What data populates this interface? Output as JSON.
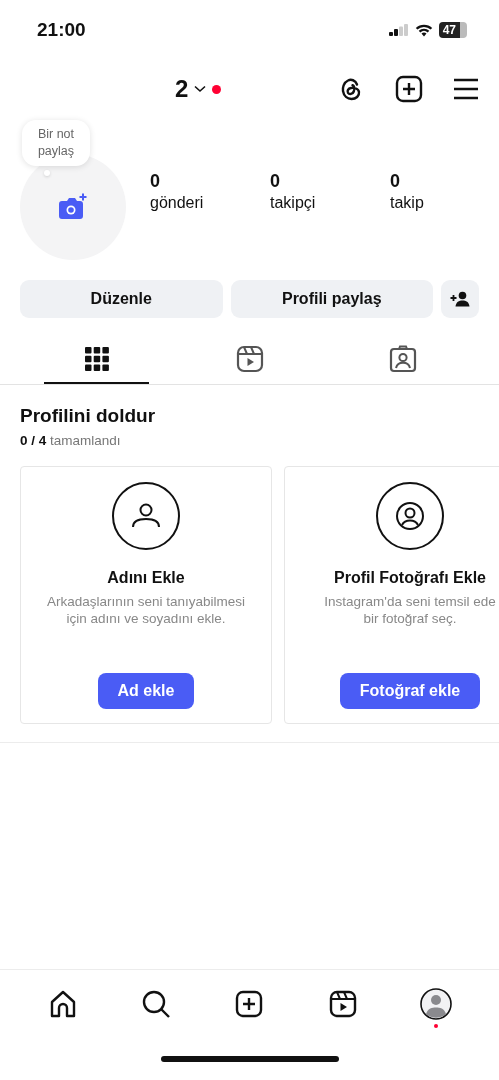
{
  "status_bar": {
    "time": "21:00",
    "battery": "47"
  },
  "header": {
    "username": "2",
    "notification": true
  },
  "profile": {
    "note_bubble": "Bir not paylaş",
    "stats": [
      {
        "value": "0",
        "label": "gönderi"
      },
      {
        "value": "0",
        "label": "takipçi"
      },
      {
        "value": "0",
        "label": "takip"
      }
    ]
  },
  "actions": [
    "Düzenle",
    "Profili paylaş"
  ],
  "tabs": [
    {
      "kind": "grid",
      "selected": true
    },
    {
      "kind": "reels",
      "selected": false
    },
    {
      "kind": "tagged",
      "selected": false
    }
  ],
  "completion": {
    "title": "Profilini doldur",
    "progress": "0 / 4",
    "progress_label": "tamamlandı",
    "cards": [
      {
        "kind": "name",
        "title": "Adını Ekle",
        "description": [
          "Arkadaşlarının seni tanıyabilmesi",
          "için adını ve soyadını ekle."
        ],
        "button": "Ad ekle"
      },
      {
        "kind": "photo",
        "title": "Profil Fotoğrafı Ekle",
        "description": [
          "Instagram'da seni temsil ede",
          "bir fotoğraf seç."
        ],
        "button": "Fotoğraf ekle"
      }
    ]
  },
  "bottom_nav": [
    {
      "kind": "home",
      "notification": false
    },
    {
      "kind": "search",
      "notification": false
    },
    {
      "kind": "create",
      "notification": false
    },
    {
      "kind": "reels",
      "notification": false
    },
    {
      "kind": "profile",
      "notification": true
    }
  ]
}
